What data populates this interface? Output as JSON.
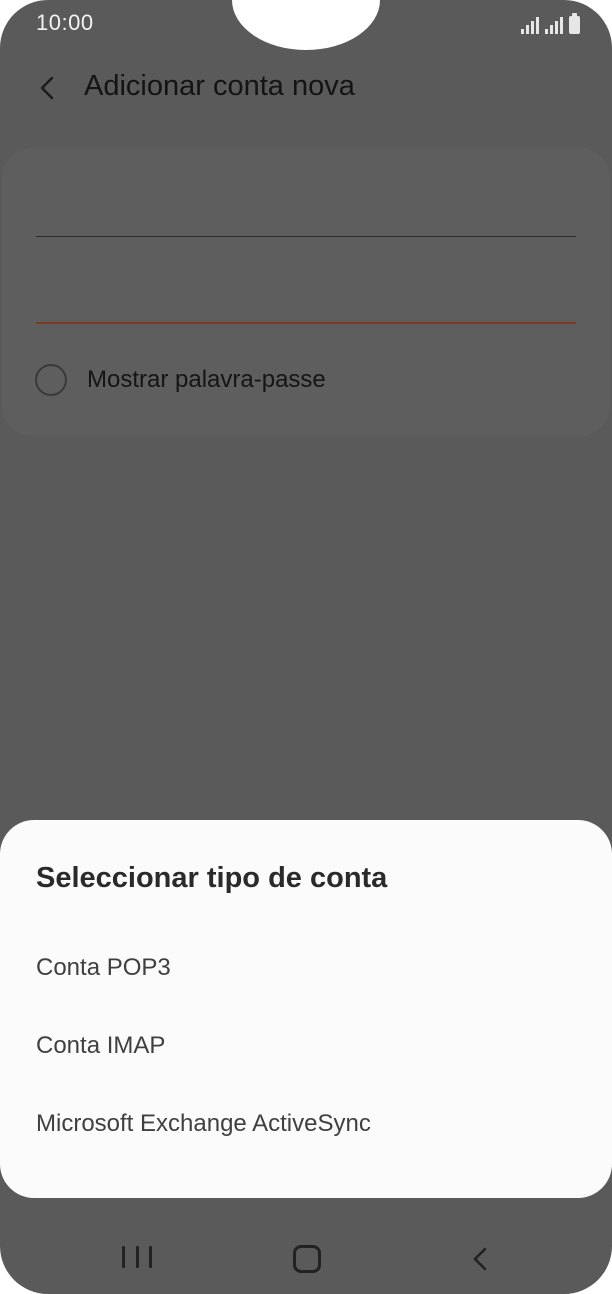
{
  "status_bar": {
    "time": "10:00",
    "icons": [
      "signal-icon",
      "signal-icon",
      "battery-icon"
    ]
  },
  "header": {
    "back_icon": "chevron-left-icon",
    "title": "Adicionar conta nova"
  },
  "form": {
    "show_password_label": "Mostrar palavra-passe"
  },
  "sheet": {
    "title": "Seleccionar tipo de conta",
    "options": [
      {
        "label": "Conta POP3"
      },
      {
        "label": "Conta IMAP"
      },
      {
        "label": "Microsoft Exchange ActiveSync"
      }
    ]
  },
  "nav_bar": {
    "icons": [
      "recent-apps-icon",
      "home-icon",
      "back-icon"
    ]
  },
  "colors": {
    "overlay": "#5a5a5a",
    "sheet_background": "#fbfbfb",
    "accent_underline": "#7a3a26"
  }
}
